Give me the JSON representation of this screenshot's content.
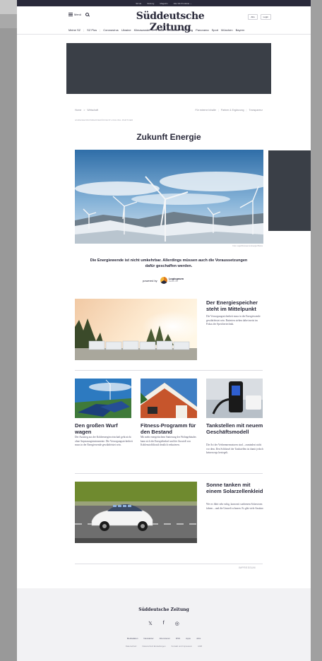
{
  "topbar": {
    "items": [
      "SZ.de",
      "Zeitung",
      "Magazin",
      "Alle SZ-Produkte ⌄"
    ]
  },
  "header": {
    "menu_label": "Menü",
    "logo": "Süddeutsche Zeitung",
    "right_items": [
      "Abo",
      "Login"
    ]
  },
  "nav": {
    "items": [
      "Meine SZ",
      "SZ Plus",
      "Coronavirus",
      "Ukraine",
      "Klimawandel",
      "Politik",
      "Wirtschaft",
      "Meinung",
      "Panorama",
      "Sport",
      "München",
      "Bayern"
    ]
  },
  "breadcrumb": {
    "left": [
      "Home",
      ">",
      "Wirtschaft"
    ],
    "right": [
      "Für externe Inhalte",
      "Partner & Ergänzung",
      "Transparenz"
    ]
  },
  "disclaimer": "ANZEIGENSONDERVERÖFFENTLICHUNG PARTNER",
  "page_title": "Zukunft Energie",
  "hero_caption": "Foto: Logo/Dinosaurus Energie Blocks",
  "lead": "Die Energiewende ist nicht umkehrbar. Allerdings müssen auch die Voraussetzungen dafür geschaffen werden.",
  "powered_by": "powered by",
  "partner": {
    "name": "Logicgeum",
    "sub": "Partner rüst"
  },
  "feature": {
    "headline": "Der Energiespeicher steht im Mittelpunkt",
    "text": "Die Versorgungssicherheit muss in der Energiewende gewährleistet sein. Batterien stehen dabei meist im Fokus der Speichertechnik."
  },
  "cards": [
    {
      "headline": "Den großen Wurf wagen",
      "text": "Der Ausstieg aus der Kohleenergiewirtschaft geht nicht ohne Anpassungsinstrumente. Die Versorgungssicherheit muss in der Energiewende gewährleistet sein."
    },
    {
      "headline": "Fitness-Programm für den Bestand",
      "text": "Mit mehr energetischem Sanierung des Wohngebäudes kann sich der Energiebedarf und der Ausstoß von Kohlenstoffdioxid deutlich reduzieren."
    },
    {
      "headline": "Tankstellen mit neuem Geschäftsmodell",
      "text": "Die Art der Verbrennermotoren sind – zumindest nicht vor dem. Den Schlüssel der Tankstellen ist damit jedoch keineswegs besiegelt."
    }
  ],
  "bottom_feature": {
    "headline": "Sonne tanken mit einem Solarzellenkleid",
    "text": "Wer es fährt sehr ruhig, kann mit sonbenem Solarstrom fahren – und die Umwelt schonen. Es gibt viele Ansätze."
  },
  "impressum": "IMPRESSUM",
  "footer": {
    "logo": "Süddeutsche Zeitung",
    "social": [
      "𝕏",
      "f",
      "◎"
    ],
    "links": [
      "Mediadaten",
      "Newsletter",
      "Abonnieren",
      "RSS",
      "Apps",
      "Jobs"
    ],
    "legal": [
      "Datenschutz",
      "Datenschutz Einstellungen",
      "Kontakt und Impressum",
      "AGB"
    ]
  },
  "colors": {
    "ad": "#3a3f47",
    "brand": "#29293a"
  }
}
